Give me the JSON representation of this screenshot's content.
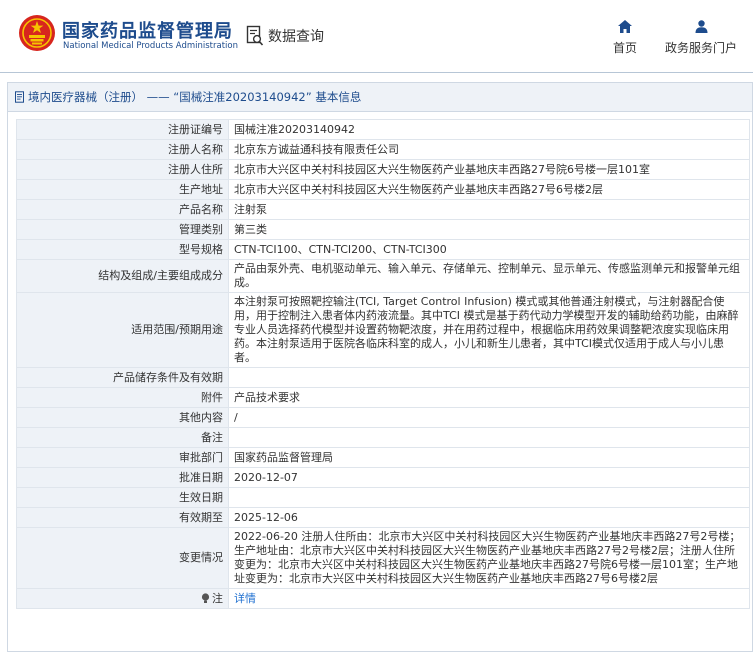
{
  "header": {
    "org_name_cn": "国家药品监督管理局",
    "org_name_en": "National Medical Products Administration",
    "query_label": "数据查询",
    "nav": [
      {
        "label": "首页",
        "icon": "home-icon"
      },
      {
        "label": "政务服务门户",
        "icon": "user-icon"
      }
    ]
  },
  "panel": {
    "title": "境内医疗器械（注册） —— “国械注准20203140942” 基本信息"
  },
  "fields": [
    {
      "label": "注册证编号",
      "value": "国械注准20203140942"
    },
    {
      "label": "注册人名称",
      "value": "北京东方诚益通科技有限责任公司"
    },
    {
      "label": "注册人住所",
      "value": "北京市大兴区中关村科技园区大兴生物医药产业基地庆丰西路27号院6号楼一层101室"
    },
    {
      "label": "生产地址",
      "value": "北京市大兴区中关村科技园区大兴生物医药产业基地庆丰西路27号6号楼2层"
    },
    {
      "label": "产品名称",
      "value": "注射泵"
    },
    {
      "label": "管理类别",
      "value": "第三类"
    },
    {
      "label": "型号规格",
      "value": "CTN-TCI100、CTN-TCI200、CTN-TCI300"
    },
    {
      "label": "结构及组成/主要组成成分",
      "value": "产品由泵外壳、电机驱动单元、输入单元、存储单元、控制单元、显示单元、传感监测单元和报警单元组成。"
    },
    {
      "label": "适用范围/预期用途",
      "value": "本注射泵可按照靶控输注(TCI, Target Control Infusion) 模式或其他普通注射模式，与注射器配合使用，用于控制注入患者体内药液流量。其中TCI 模式是基于药代动力学模型开发的辅助给药功能，由麻醉专业人员选择药代模型并设置药物靶浓度，并在用药过程中，根据临床用药效果调整靶浓度实现临床用药。本注射泵适用于医院各临床科室的成人，小儿和新生儿患者，其中TCI模式仅适用于成人与小儿患者。"
    },
    {
      "label": "产品储存条件及有效期",
      "value": ""
    },
    {
      "label": "附件",
      "value": "产品技术要求"
    },
    {
      "label": "其他内容",
      "value": "/"
    },
    {
      "label": "备注",
      "value": ""
    },
    {
      "label": "审批部门",
      "value": "国家药品监督管理局"
    },
    {
      "label": "批准日期",
      "value": "2020-12-07"
    },
    {
      "label": "生效日期",
      "value": ""
    },
    {
      "label": "有效期至",
      "value": "2025-12-06"
    },
    {
      "label": "变更情况",
      "value": "2022-06-20 注册人住所由：北京市大兴区中关村科技园区大兴生物医药产业基地庆丰西路27号2号楼；生产地址由：北京市大兴区中关村科技园区大兴生物医药产业基地庆丰西路27号2号楼2层；注册人住所变更为：北京市大兴区中关村科技园区大兴生物医药产业基地庆丰西路27号院6号楼一层101室；生产地址变更为：北京市大兴区中关村科技园区大兴生物医药产业基地庆丰西路27号6号楼2层"
    }
  ],
  "note": {
    "label": "注",
    "link_text": "详情"
  }
}
